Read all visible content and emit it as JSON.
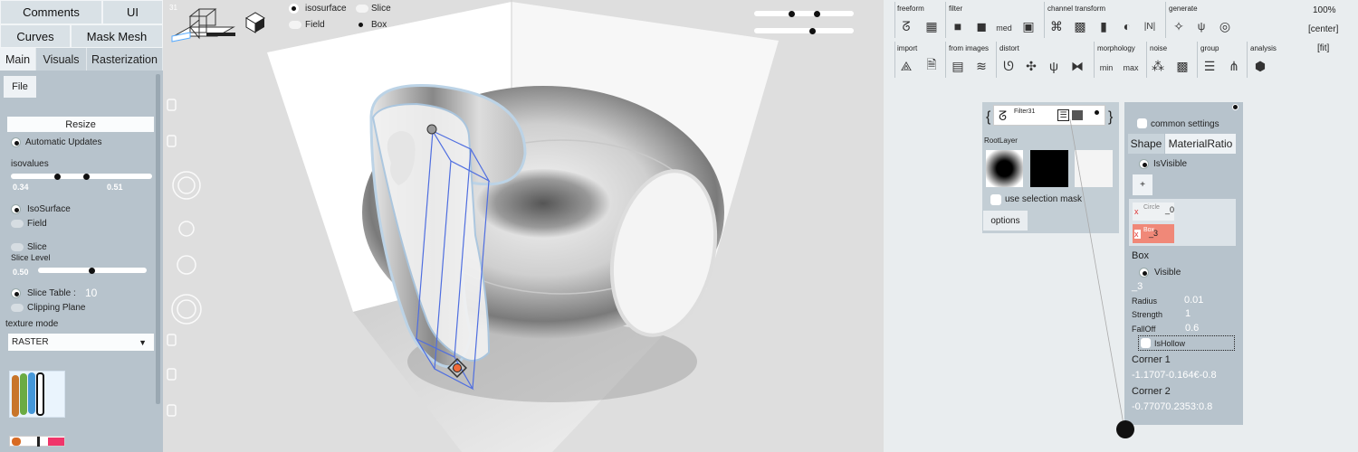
{
  "top_buttons": [
    "Comments",
    "UI",
    "Curves",
    "Mask Mesh"
  ],
  "tabs": [
    "Main",
    "Visuals",
    "Rasterization"
  ],
  "file_label": "File",
  "resize_label": "Resize",
  "automatic_updates": "Automatic Updates",
  "isovalues_label": "isovalues",
  "iso_low": "0.34",
  "iso_high": "0.51",
  "isosurface_label": "IsoSurface",
  "field_label": "Field",
  "slice_label": "Slice",
  "slice_level_label": "Slice Level",
  "slice_level_value": "0.50",
  "slice_table_label": "Slice Table :",
  "slice_table_value": "10",
  "clipping_plane_label": "Clipping Plane",
  "texture_mode_label": "texture mode",
  "texture_mode_value": "RASTER",
  "viewport": {
    "frame_number": "31",
    "isosurface_label": "isosurface",
    "slice_label": "Slice",
    "field_label": "Field",
    "box_label": "Box"
  },
  "toolbar": {
    "groups": [
      "freeform",
      "filter",
      "channel transform",
      "generate",
      "import",
      "from images",
      "distort",
      "morphology",
      "noise",
      "group",
      "analysis"
    ],
    "filter_med": "med",
    "morph_min": "min",
    "morph_max": "max",
    "channel_n": "|N|",
    "zoom": "100%",
    "center": "[center]",
    "fit": "[fit]"
  },
  "filter_panel": {
    "brace_open": "{",
    "brace_close": "}",
    "filter_name": "Filter31",
    "root_layer": "RootLayer",
    "use_selection_mask": "use selection mask",
    "options": "options"
  },
  "props_panel": {
    "common_settings": "common settings",
    "tab_shape": "Shape",
    "tab_material": "MaterialRatio",
    "is_visible": "IsVisible",
    "plus": "+",
    "shape_items": [
      {
        "name": "Circle",
        "index": "_0"
      },
      {
        "name": "Box",
        "index": "_3"
      }
    ],
    "box_label": "Box",
    "visible_label": "Visible",
    "box_index": "_3",
    "radius_label": "Radius",
    "radius_value": "0.01",
    "strength_label": "Strength",
    "strength_value": "1",
    "falloff_label": "FallOff",
    "falloff_value": "0.6",
    "is_hollow": "IsHollow",
    "corner1_label": "Corner 1",
    "corner1_value": "-1.1707-0.164€-0.8",
    "corner2_label": "Corner 2",
    "corner2_value": "-0.77070.2353:0.8"
  },
  "colors": {
    "panel_bg": "#b7c3cc",
    "active_item": "#f08878",
    "accent_blue": "#3a5fe0"
  }
}
